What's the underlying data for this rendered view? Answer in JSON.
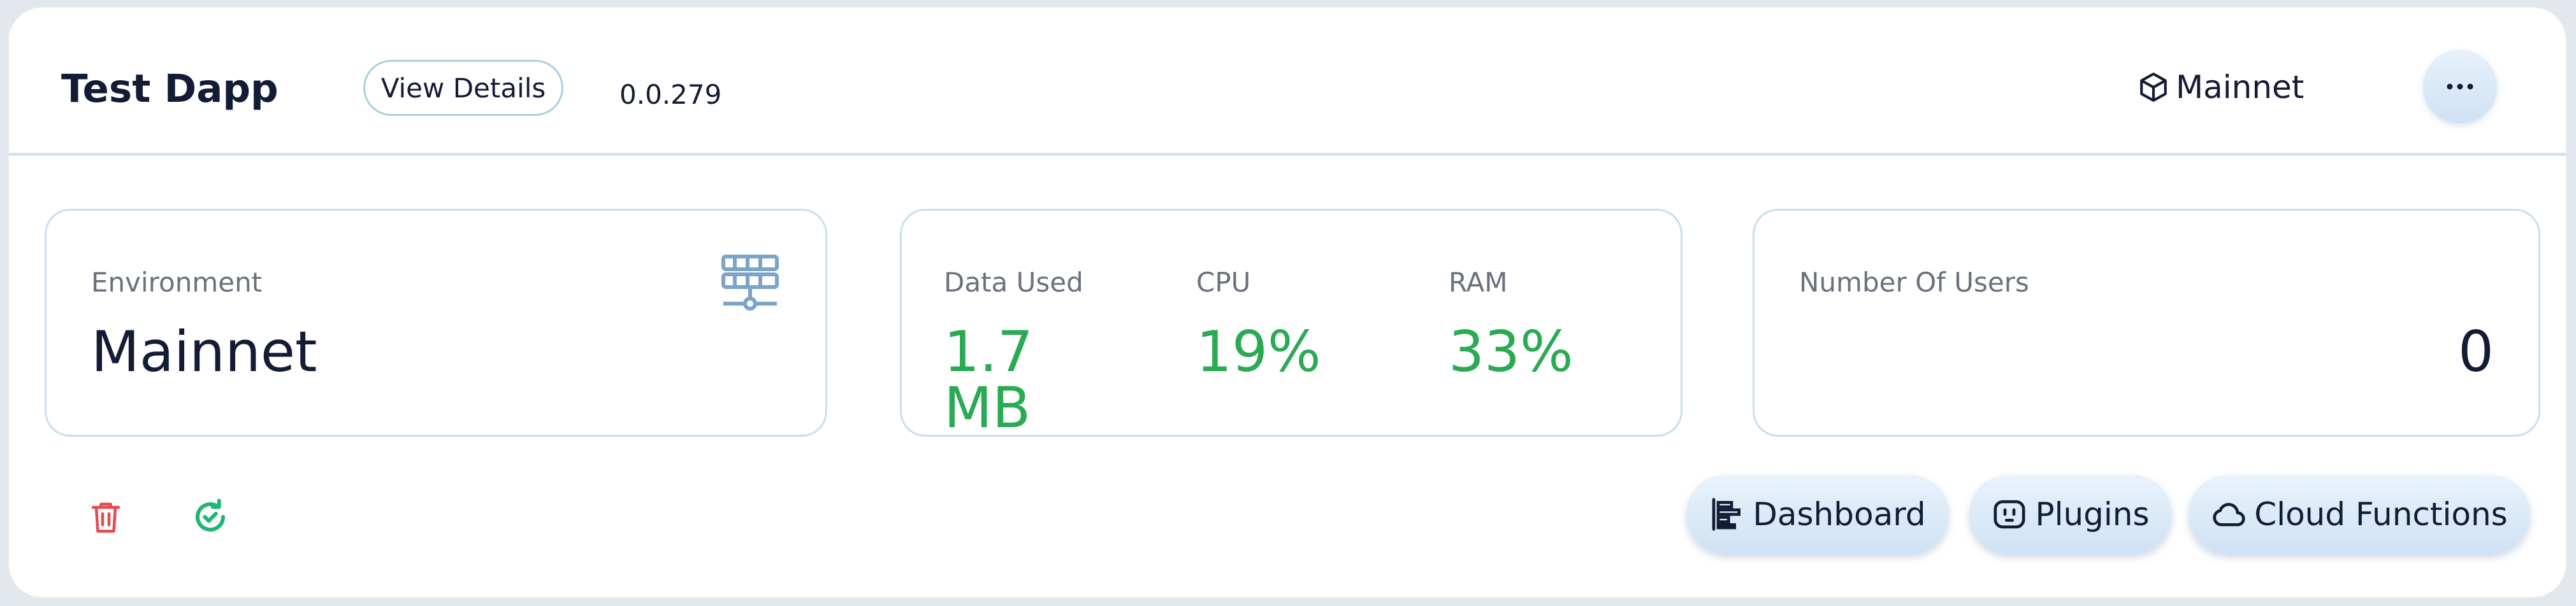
{
  "header": {
    "title": "Test Dapp",
    "view_details_label": "View Details",
    "version": "0.0.279",
    "network_label": "Mainnet"
  },
  "environment": {
    "label": "Environment",
    "value": "Mainnet"
  },
  "stats": {
    "data_used_label": "Data Used",
    "data_used_value": "1.7 MB",
    "cpu_label": "CPU",
    "cpu_value": "19%",
    "ram_label": "RAM",
    "ram_value": "33%"
  },
  "users": {
    "label": "Number Of Users",
    "value": "0"
  },
  "actions": {
    "dashboard_label": "Dashboard",
    "plugins_label": "Plugins",
    "cloud_functions_label": "Cloud Functions"
  },
  "icons": {
    "network": "cube-icon",
    "more": "more-horizontal-icon",
    "environment": "server-network-icon",
    "delete": "trash-icon",
    "refresh": "refresh-check-icon",
    "dashboard": "bar-chart-icon",
    "plugins": "plug-socket-icon",
    "cloud": "cloud-icon"
  },
  "colors": {
    "accent_green": "#2aaa53",
    "danger_red": "#e5484d",
    "refresh_green": "#22b573",
    "icon_blue": "#7ba4c7",
    "border_blue": "#c7dfee",
    "text_dark": "#131c35",
    "text_muted": "#68717d"
  }
}
